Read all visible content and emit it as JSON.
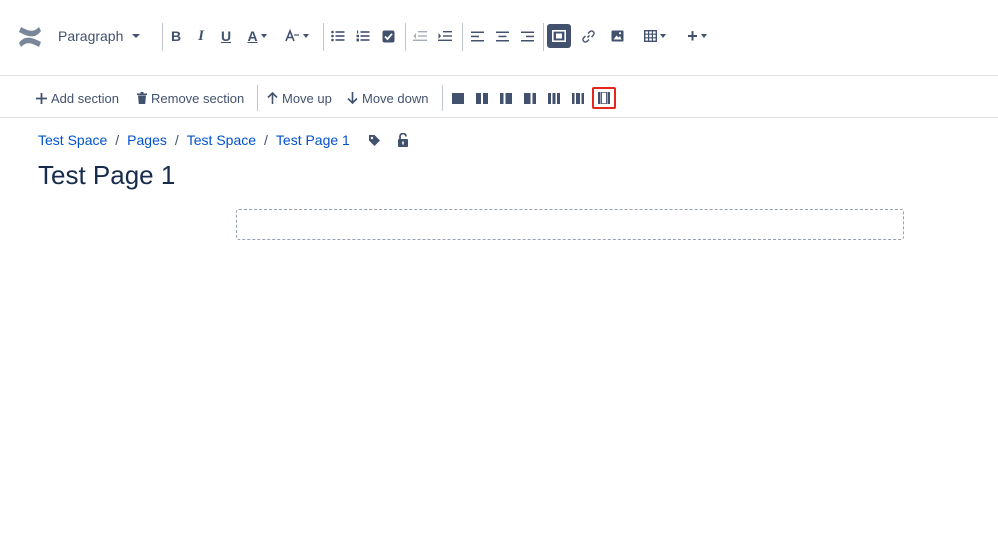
{
  "toolbar": {
    "paragraph_label": "Paragraph",
    "bold_glyph": "B",
    "italic_glyph": "I",
    "underline_glyph": "U",
    "text_color_glyph": "A",
    "add_glyph": "+",
    "icons": [
      "confluence-logo",
      "bold",
      "italic",
      "underline",
      "text-color",
      "text-style",
      "bullet-list",
      "numbered-list",
      "task-list",
      "outdent",
      "indent",
      "align-left",
      "align-center",
      "align-right",
      "page-layout",
      "link",
      "image",
      "table",
      "insert"
    ]
  },
  "layout_toolbar": {
    "add_section": "Add section",
    "remove_section": "Remove section",
    "move_up": "Move up",
    "move_down": "Move down",
    "column_layouts": [
      "single-column",
      "two-column",
      "two-column-left-sidebar",
      "two-column-right-sidebar",
      "three-column",
      "three-column-sidebars",
      "single-column-with-sidebars"
    ],
    "selected_layout": "single-column-with-sidebars",
    "highlight_color": "#e5261c"
  },
  "breadcrumb": {
    "items": [
      "Test Space",
      "Pages",
      "Test Space",
      "Test Page 1"
    ],
    "separator": "/"
  },
  "page": {
    "title": "Test Page 1"
  },
  "colors": {
    "link": "#0052cc",
    "text": "#172b4d",
    "icon": "#42526e"
  }
}
